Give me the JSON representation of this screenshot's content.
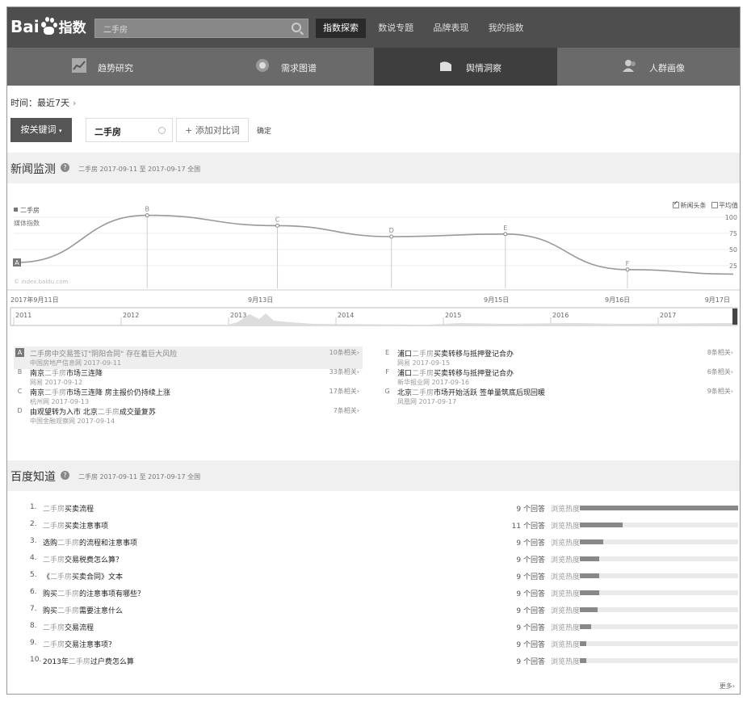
{
  "header": {
    "logo_text": "Bai",
    "logo_cn": "指数",
    "search_value": "二手房",
    "nav": [
      {
        "label": "指数探索",
        "active": true
      },
      {
        "label": "数说专题",
        "active": false
      },
      {
        "label": "品牌表现",
        "active": false
      },
      {
        "label": "我的指数",
        "active": false
      }
    ]
  },
  "subnav": [
    {
      "label": "趋势研究",
      "icon": "trend-chart-icon"
    },
    {
      "label": "需求图谱",
      "icon": "demand-map-icon"
    },
    {
      "label": "舆情洞察",
      "icon": "sentiment-icon",
      "active": true
    },
    {
      "label": "人群画像",
      "icon": "user-profile-icon"
    }
  ],
  "filters": {
    "time_label": "时间：最近7天",
    "chevron": "›",
    "keyword_button": "按关键词",
    "keyword_caret": "▾",
    "keyword_value": "二手房",
    "add_compare": "+ 添加对比词",
    "confirm": "确定"
  },
  "news_section": {
    "title": "新闻监测",
    "help": "?",
    "meta": "二手房   2017-09-11 至 2017-09-17   全国"
  },
  "chart": {
    "legend_keyword": "二手房",
    "ylabel": "媒体指数",
    "opt_headlines": "新闻头条",
    "opt_average": "平均值",
    "watermark": "© index.baidu.com",
    "x_labels": [
      "2017年9月11日",
      "9月13日",
      "9月15日",
      "9月16日",
      "9月17日"
    ],
    "timeline_years": [
      "2011",
      "2012",
      "2013",
      "2014",
      "2015",
      "2016",
      "2017"
    ]
  },
  "chart_data": {
    "type": "line",
    "title": "",
    "xlabel": "",
    "ylabel": "媒体指数",
    "y_ticks": [
      100,
      75,
      50,
      25
    ],
    "ylim": [
      0,
      110
    ],
    "grid": true,
    "legend": "top-left",
    "series": [
      {
        "name": "二手房",
        "points": [
          {
            "label": "A",
            "x": 0.0,
            "y": 30
          },
          {
            "label": "B",
            "x": 0.8,
            "y": 103
          },
          {
            "label": "C",
            "x": 1.6,
            "y": 87
          },
          {
            "label": "D",
            "x": 2.3,
            "y": 70
          },
          {
            "label": "E",
            "x": 3.0,
            "y": 74
          },
          {
            "label": "F",
            "x": 3.75,
            "y": 19
          },
          {
            "label": "",
            "x": 4.4,
            "y": 12
          }
        ]
      }
    ]
  },
  "news": [
    {
      "letter": "A",
      "title_pre": "",
      "title_kw": "二手房中交易签订\"阴阳合同\" 存在着巨大风险",
      "title_post": "",
      "source": "中国房地产信息网 2017-09-11",
      "related": "10条相关›",
      "highlight": true
    },
    {
      "letter": "B",
      "title_pre": "南京",
      "title_kw": "二手房",
      "title_post": "市场三连降",
      "source": "网易 2017-09-12",
      "related": "33条相关›"
    },
    {
      "letter": "C",
      "title_pre": "南京",
      "title_kw": "二手房",
      "title_post": "市场三连降 房主报价仍持续上涨",
      "source": "杭州网 2017-09-13",
      "related": "17条相关›"
    },
    {
      "letter": "D",
      "title_pre": "由观望转为入市 北京",
      "title_kw": "二手房",
      "title_post": "成交量复苏",
      "source": "中国金融观察网 2017-09-14",
      "related": "7条相关›"
    },
    {
      "letter": "E",
      "title_pre": "浦口",
      "title_kw": "二手房",
      "title_post": "买卖转移与抵押登记合办",
      "source": "网易 2017-09-15",
      "related": "8条相关›"
    },
    {
      "letter": "F",
      "title_pre": "浦口",
      "title_kw": "二手房",
      "title_post": "买卖转移与抵押登记合办",
      "source": "新华报业网 2017-09-16",
      "related": "6条相关›"
    },
    {
      "letter": "G",
      "title_pre": "北京",
      "title_kw": "二手房",
      "title_post": "市场开始活跃 签单量筑底后现回暖",
      "source": "凤凰网 2017-09-17",
      "related": "9条相关›"
    }
  ],
  "zhidao_section": {
    "title": "百度知道",
    "help": "?",
    "meta": "二手房   2017-09-11 至 2017-09-17   全国"
  },
  "zhidao": [
    {
      "idx": "1.",
      "pre": "",
      "kw": "二手房",
      "post": "买卖流程",
      "answers": "9 个回答",
      "heat_label": "浏览热度",
      "heat": 1.0
    },
    {
      "idx": "2.",
      "pre": "",
      "kw": "二手房",
      "post": "买卖注意事项",
      "answers": "11 个回答",
      "heat_label": "浏览热度",
      "heat": 0.27
    },
    {
      "idx": "3.",
      "pre": "选购",
      "kw": "二手房",
      "post": "的流程和注意事项",
      "answers": "9 个回答",
      "heat_label": "浏览热度",
      "heat": 0.15
    },
    {
      "idx": "4.",
      "pre": "",
      "kw": "二手房",
      "post": "交易税费怎么算？",
      "answers": "9 个回答",
      "heat_label": "浏览热度",
      "heat": 0.12
    },
    {
      "idx": "5.",
      "pre": "《",
      "kw": "二手房",
      "post": "买卖合同》文本",
      "answers": "9 个回答",
      "heat_label": "浏览热度",
      "heat": 0.12
    },
    {
      "idx": "6.",
      "pre": "购买",
      "kw": "二手房",
      "post": "的注意事项有哪些？",
      "answers": "9 个回答",
      "heat_label": "浏览热度",
      "heat": 0.12
    },
    {
      "idx": "7.",
      "pre": "购买",
      "kw": "二手房",
      "post": "需要注意什么",
      "answers": "9 个回答",
      "heat_label": "浏览热度",
      "heat": 0.11
    },
    {
      "idx": "8.",
      "pre": "",
      "kw": "二手房",
      "post": "交易流程",
      "answers": "9 个回答",
      "heat_label": "浏览热度",
      "heat": 0.07
    },
    {
      "idx": "9.",
      "pre": "",
      "kw": "二手房",
      "post": "交易注意事项？",
      "answers": "9 个回答",
      "heat_label": "浏览热度",
      "heat": 0.04
    },
    {
      "idx": "10.",
      "pre": "2013年",
      "kw": "二手房",
      "post": "过户费怎么算",
      "answers": "9 个回答",
      "heat_label": "浏览热度",
      "heat": 0.04
    }
  ],
  "more_link": "更多›"
}
